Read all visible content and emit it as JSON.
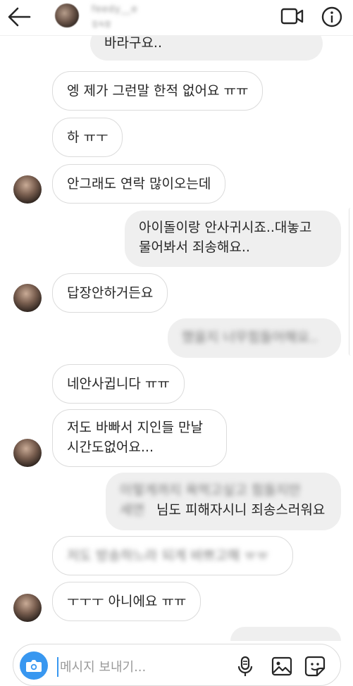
{
  "header": {
    "name": "feedy__e",
    "status": "접속함"
  },
  "messages": [
    {
      "side": "outgoing",
      "text": "바라구요..",
      "blurred": false
    },
    {
      "side": "incoming",
      "text": "엥 제가 그런말 한적 없어요 ㅠㅠ",
      "blurred": false
    },
    {
      "side": "incoming",
      "text": "하 ㅠㅜ",
      "blurred": false
    },
    {
      "side": "incoming",
      "text": "안그래도 연락 많이오는데",
      "blurred": false
    },
    {
      "side": "outgoing",
      "lines": [
        "아이돌이랑 안사귀시죠..대놓고",
        "물어봐서 죄송해요.."
      ],
      "blurred": false
    },
    {
      "side": "incoming",
      "text": "답장안하거든요",
      "blurred": false
    },
    {
      "side": "outgoing",
      "text": "했을지 너무힘들어해요..",
      "blurred": true
    },
    {
      "side": "incoming",
      "text": "네안사귑니다 ㅠㅠ",
      "blurred": false
    },
    {
      "side": "incoming",
      "lines": [
        "저도 바빠서 지인들 만날",
        "시간도없어요..."
      ],
      "blurred": false
    },
    {
      "side": "outgoing",
      "lines": [
        "이렇게까지 욕먹고싶고 힘들지만",
        "세연님도 피해자시니 죄송스러워요"
      ],
      "blurred_partial": true,
      "visible_tail": "님도 피해자시니 죄송스러워요"
    },
    {
      "side": "incoming",
      "text": "저도 방송하느라 되게 바쁘고해 ㅠㅠ",
      "blurred": true
    },
    {
      "side": "incoming",
      "text": "ㅜㅜㅜ 아니에요 ㅠㅠ",
      "blurred": false
    }
  ],
  "composer": {
    "placeholder": "메시지 보내기..."
  },
  "icons": {
    "back": "back-arrow-icon",
    "video": "video-call-icon",
    "info": "info-icon",
    "camera": "camera-icon",
    "mic": "microphone-icon",
    "gallery": "gallery-icon",
    "sticker": "sticker-icon"
  },
  "colors": {
    "accent": "#3897f0",
    "incoming_border": "#dbdbdb",
    "outgoing_bg": "#efefef"
  }
}
